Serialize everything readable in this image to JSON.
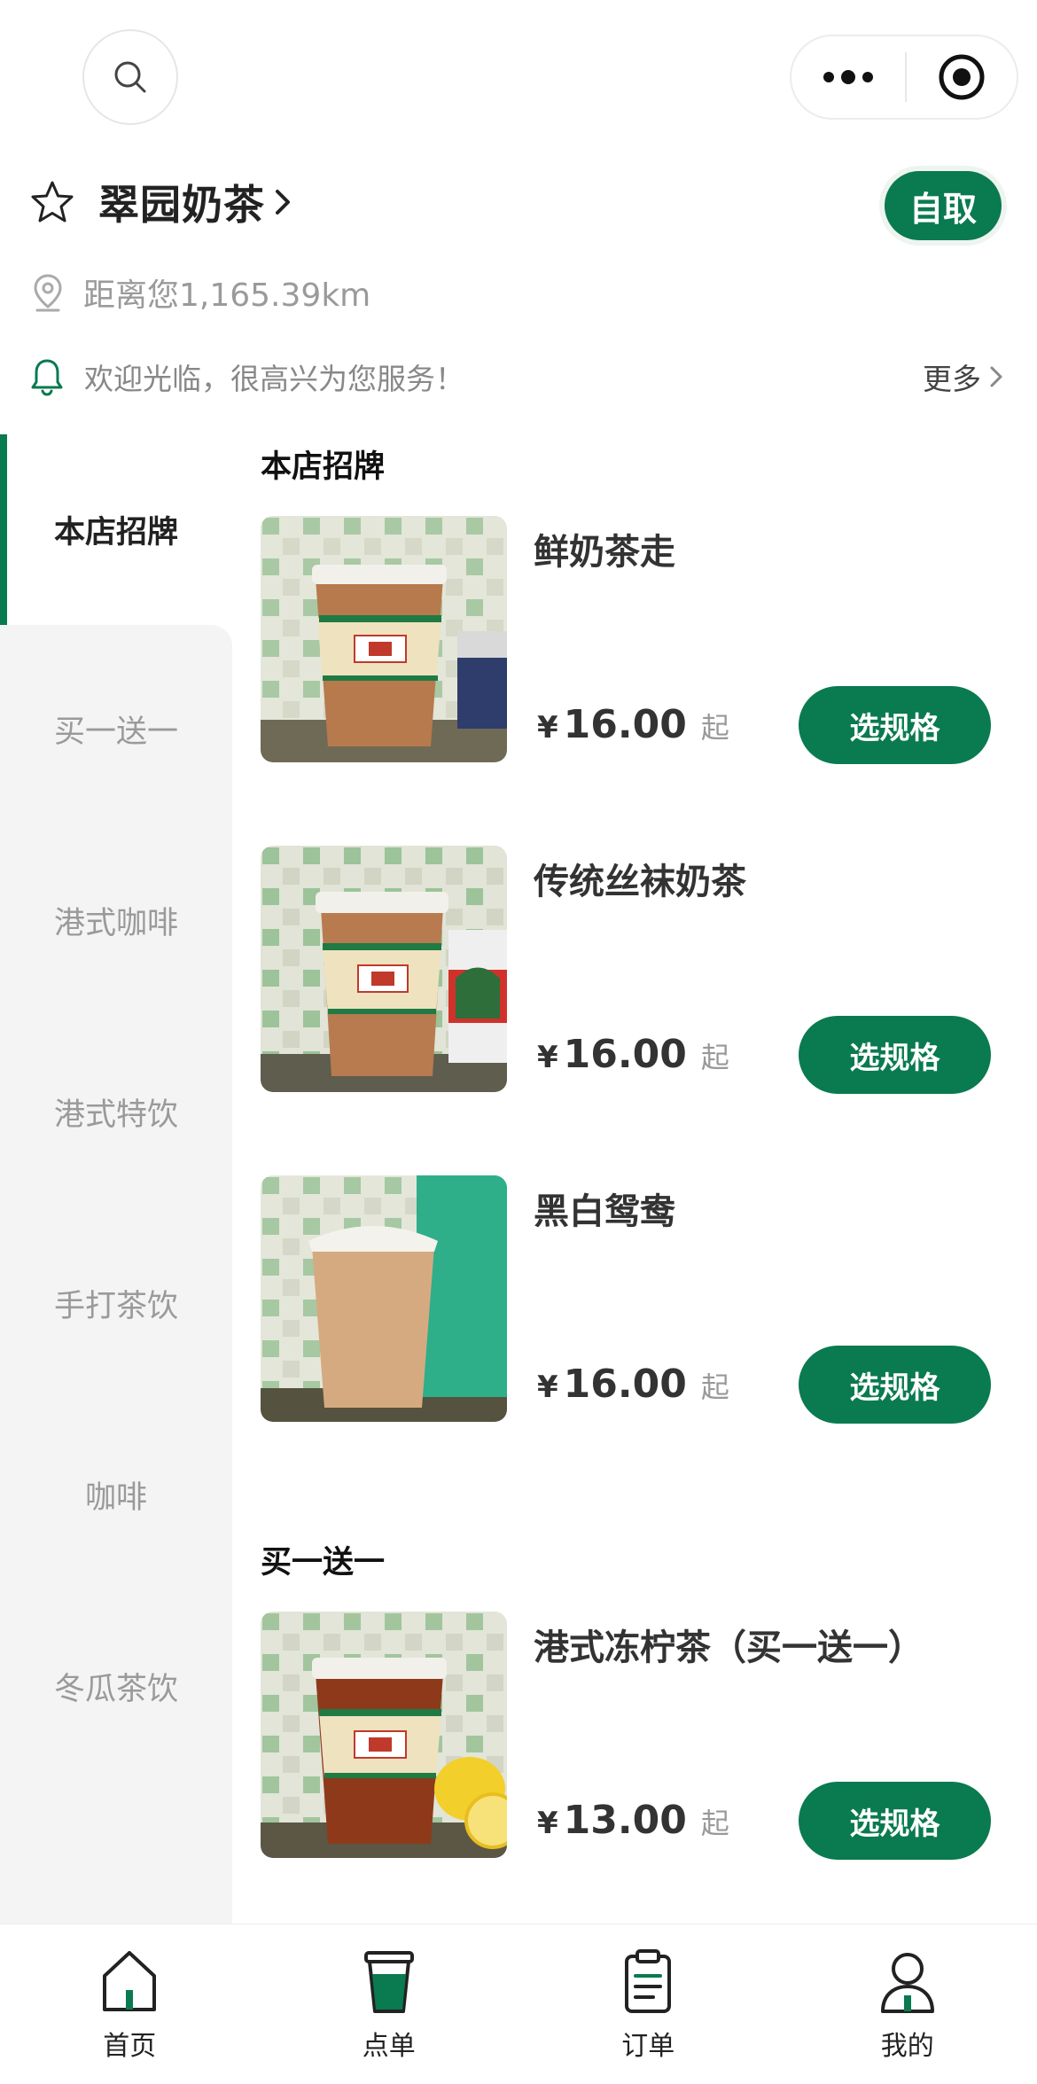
{
  "colors": {
    "brand": "#0a7a50",
    "sidebar_bg": "#f4f4f4",
    "muted": "#9a9a9a"
  },
  "header": {
    "store_name": "翠园奶茶",
    "pickup_label": "自取",
    "distance": "距离您1,165.39km",
    "notice": "欢迎光临，很高兴为您服务！",
    "notice_more": "更多"
  },
  "sidebar": {
    "items": [
      {
        "label": "本店招牌"
      },
      {
        "label": "买一送一"
      },
      {
        "label": "港式咖啡"
      },
      {
        "label": "港式特饮"
      },
      {
        "label": "手打茶饮"
      },
      {
        "label": "咖啡"
      },
      {
        "label": "冬瓜茶饮"
      }
    ]
  },
  "sections": [
    {
      "title": "本店招牌",
      "products": [
        {
          "name": "鲜奶茶走",
          "currency": "¥",
          "price": "16.00",
          "suffix": "起",
          "button": "选规格",
          "image_icon": "milk-tea-image"
        },
        {
          "name": "传统丝袜奶茶",
          "currency": "¥",
          "price": "16.00",
          "suffix": "起",
          "button": "选规格",
          "image_icon": "milk-tea-image"
        },
        {
          "name": "黑白鸳鸯",
          "currency": "¥",
          "price": "16.00",
          "suffix": "起",
          "button": "选规格",
          "image_icon": "milk-tea-image"
        }
      ]
    },
    {
      "title": "买一送一",
      "products": [
        {
          "name": "港式冻柠茶（买一送一）",
          "currency": "¥",
          "price": "13.00",
          "suffix": "起",
          "button": "选规格",
          "image_icon": "lemon-tea-image"
        }
      ]
    }
  ],
  "tabbar": {
    "items": [
      {
        "label": "首页",
        "icon": "home-icon"
      },
      {
        "label": "点单",
        "icon": "cup-icon"
      },
      {
        "label": "订单",
        "icon": "order-icon"
      },
      {
        "label": "我的",
        "icon": "user-icon"
      }
    ]
  }
}
